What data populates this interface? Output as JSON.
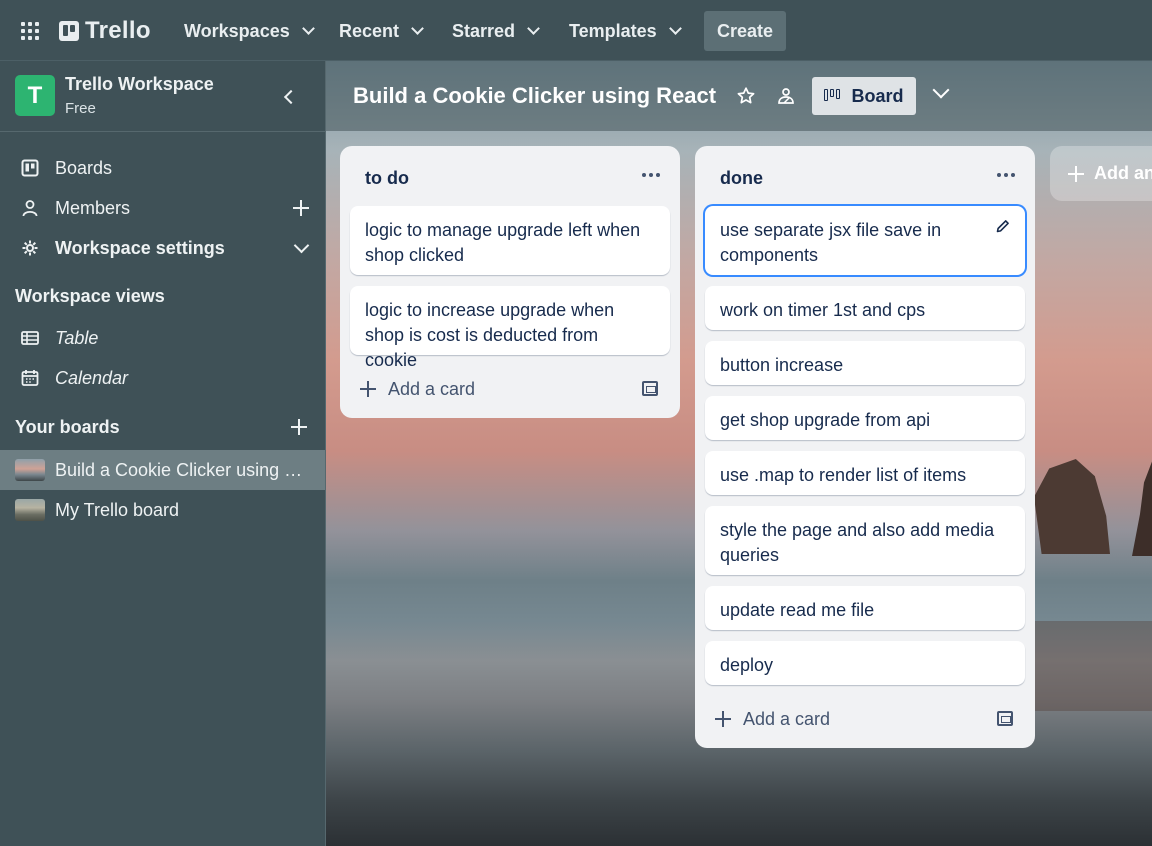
{
  "topnav": {
    "logo_text": "Trello",
    "menus": [
      {
        "label": "Workspaces"
      },
      {
        "label": "Recent"
      },
      {
        "label": "Starred"
      },
      {
        "label": "Templates"
      }
    ],
    "create_label": "Create"
  },
  "sidebar": {
    "workspace_initial": "T",
    "workspace_name": "Trello Workspace",
    "workspace_plan": "Free",
    "items": [
      {
        "label": "Boards",
        "icon": "board-icon"
      },
      {
        "label": "Members",
        "icon": "person-icon"
      },
      {
        "label": "Workspace settings",
        "icon": "gear-icon"
      }
    ],
    "views_title": "Workspace views",
    "views": [
      {
        "label": "Table",
        "icon": "table-icon"
      },
      {
        "label": "Calendar",
        "icon": "calendar-icon"
      }
    ],
    "your_boards_title": "Your boards",
    "boards": [
      {
        "label": "Build a Cookie Clicker using React",
        "active": true
      },
      {
        "label": "My Trello board",
        "active": false
      }
    ]
  },
  "board": {
    "title": "Build a Cookie Clicker using React",
    "view_label": "Board",
    "add_list_label": "Add another list",
    "lists": [
      {
        "title": "to do",
        "cards": [
          "logic to manage upgrade left when shop clicked",
          "logic to increase upgrade when shop is cost is deducted from cookie"
        ],
        "add_card_label": "Add a card"
      },
      {
        "title": "done",
        "cards": [
          "use separate jsx file save in components",
          "work on timer 1st and cps",
          "button increase",
          "get shop upgrade from api",
          "use .map to render list of items",
          "style the page and also add media queries",
          "update read me file",
          "deploy"
        ],
        "add_card_label": "Add a card"
      }
    ]
  },
  "colors": {
    "nav_bg": "#3f5157",
    "workspace_avatar": "#2db471",
    "focus_ring": "#388bff",
    "list_bg": "#f1f2f4"
  }
}
